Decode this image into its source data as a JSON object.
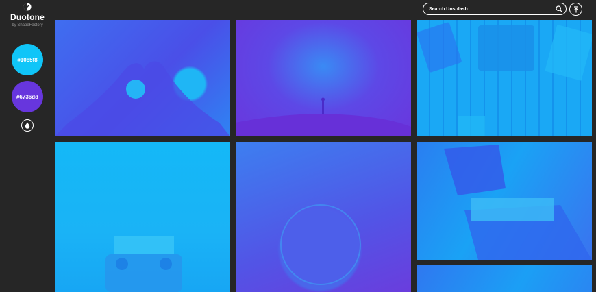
{
  "brand": {
    "name": "Duotone",
    "byline": "by ShapeFactory"
  },
  "palette": {
    "color_one": "#10c5f8",
    "color_two": "#6736dd"
  },
  "search": {
    "placeholder": "Search Unsplash"
  },
  "icons": {
    "logo": "half-circle-logo-icon",
    "drop": "water-drop-icon",
    "search": "search-icon",
    "back_to_top": "arrow-up-to-line-icon"
  }
}
